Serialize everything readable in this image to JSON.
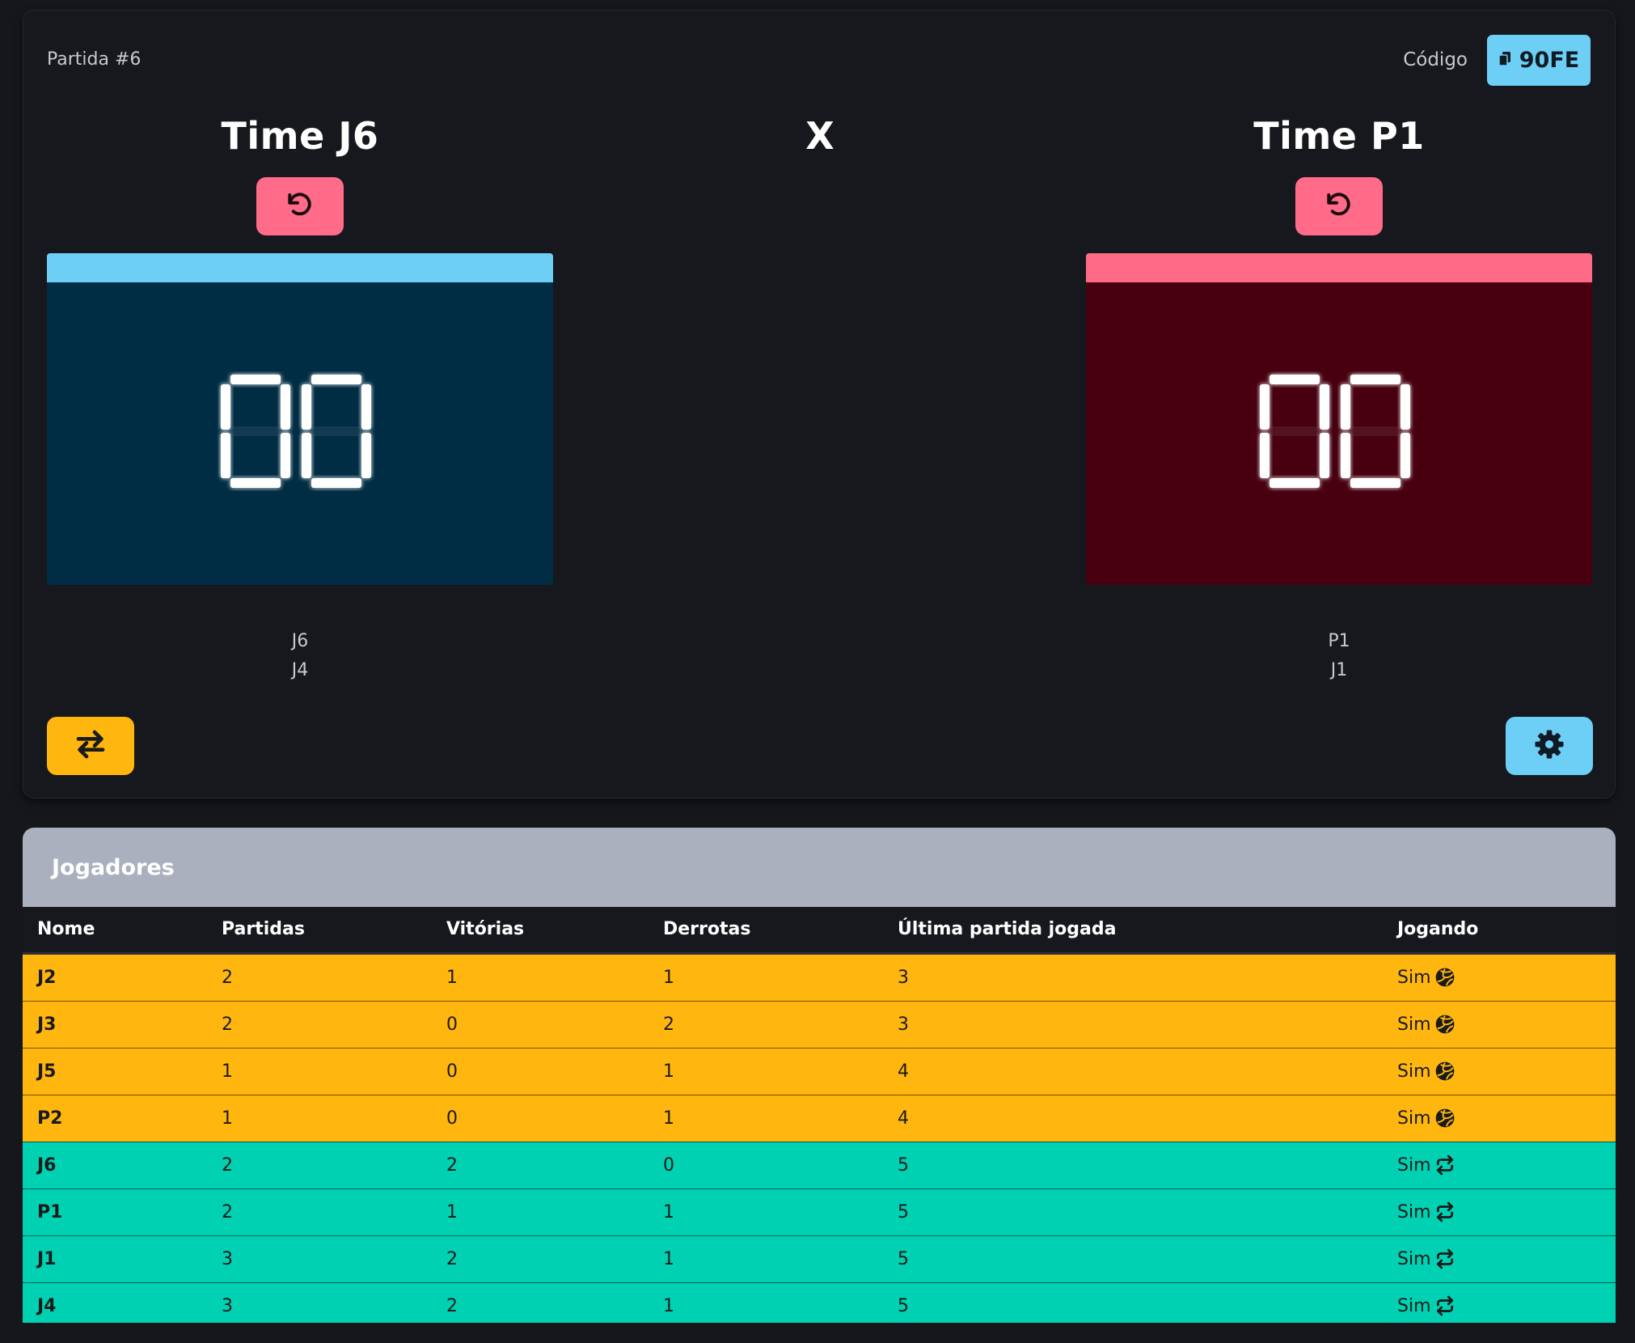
{
  "match": {
    "label": "Partida #6",
    "code_label": "Código",
    "code_value": "90FE"
  },
  "versus": "X",
  "teams": [
    {
      "title": "Time J6",
      "score": "00",
      "color": "#6dcff6",
      "panel_bg": "#002d44",
      "players": [
        "J6",
        "J4"
      ]
    },
    {
      "title": "Time P1",
      "score": "00",
      "color": "#ff6a86",
      "panel_bg": "#480010",
      "players": [
        "P1",
        "J1"
      ]
    }
  ],
  "buttons": {
    "undo_icon": "rotate-left-icon",
    "swap_icon": "swap-arrows-icon",
    "settings_icon": "gear-icon",
    "copy_icon": "copy-icon"
  },
  "players_panel": {
    "title": "Jogadores",
    "columns": [
      "Nome",
      "Partidas",
      "Vitórias",
      "Derrotas",
      "Última partida jogada",
      "Jogando"
    ],
    "rows": [
      {
        "name": "J2",
        "partidas": "2",
        "vitorias": "1",
        "derrotas": "1",
        "ultima": "3",
        "jogando": "Sim",
        "icon": "volleyball-icon",
        "state": "playing"
      },
      {
        "name": "J3",
        "partidas": "2",
        "vitorias": "0",
        "derrotas": "2",
        "ultima": "3",
        "jogando": "Sim",
        "icon": "volleyball-icon",
        "state": "playing"
      },
      {
        "name": "J5",
        "partidas": "1",
        "vitorias": "0",
        "derrotas": "1",
        "ultima": "4",
        "jogando": "Sim",
        "icon": "volleyball-icon",
        "state": "playing"
      },
      {
        "name": "P2",
        "partidas": "1",
        "vitorias": "0",
        "derrotas": "1",
        "ultima": "4",
        "jogando": "Sim",
        "icon": "volleyball-icon",
        "state": "playing"
      },
      {
        "name": "J6",
        "partidas": "2",
        "vitorias": "2",
        "derrotas": "0",
        "ultima": "5",
        "jogando": "Sim",
        "icon": "repeat-icon",
        "state": "next"
      },
      {
        "name": "P1",
        "partidas": "2",
        "vitorias": "1",
        "derrotas": "1",
        "ultima": "5",
        "jogando": "Sim",
        "icon": "repeat-icon",
        "state": "next"
      },
      {
        "name": "J1",
        "partidas": "3",
        "vitorias": "2",
        "derrotas": "1",
        "ultima": "5",
        "jogando": "Sim",
        "icon": "repeat-icon",
        "state": "next"
      },
      {
        "name": "J4",
        "partidas": "3",
        "vitorias": "2",
        "derrotas": "1",
        "ultima": "5",
        "jogando": "Sim",
        "icon": "repeat-icon",
        "state": "next"
      }
    ]
  },
  "colors": {
    "playing_row": "#ffb70f",
    "next_row": "#00d1b2",
    "header_bg": "#aab0bd",
    "undo_button": "#ff6b88",
    "swap_button": "#ffb70f",
    "settings_button": "#6dcff6"
  }
}
